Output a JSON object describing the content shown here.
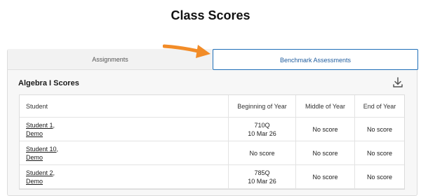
{
  "page": {
    "title": "Class Scores"
  },
  "tabs": {
    "assignments": "Assignments",
    "benchmark": "Benchmark Assessments"
  },
  "section": {
    "title": "Algebra I Scores",
    "icon": "download-icon"
  },
  "table": {
    "headers": [
      "Student",
      "Beginning of Year",
      "Middle of Year",
      "End of Year"
    ],
    "rows": [
      {
        "student_line1": "Student 1,",
        "student_line2": "Demo",
        "boy_line1": "710Q",
        "boy_line2": "10 Mar 26",
        "moy": "No score",
        "eoy": "No score"
      },
      {
        "student_line1": "Student 10,",
        "student_line2": "Demo",
        "boy_line1": "No score",
        "boy_line2": "",
        "moy": "No score",
        "eoy": "No score"
      },
      {
        "student_line1": "Student 2,",
        "student_line2": "Demo",
        "boy_line1": "785Q",
        "boy_line2": "10 Mar 26",
        "moy": "No score",
        "eoy": "No score"
      }
    ]
  },
  "colors": {
    "accent": "#1f6fb8",
    "arrow": "#f28c28"
  }
}
